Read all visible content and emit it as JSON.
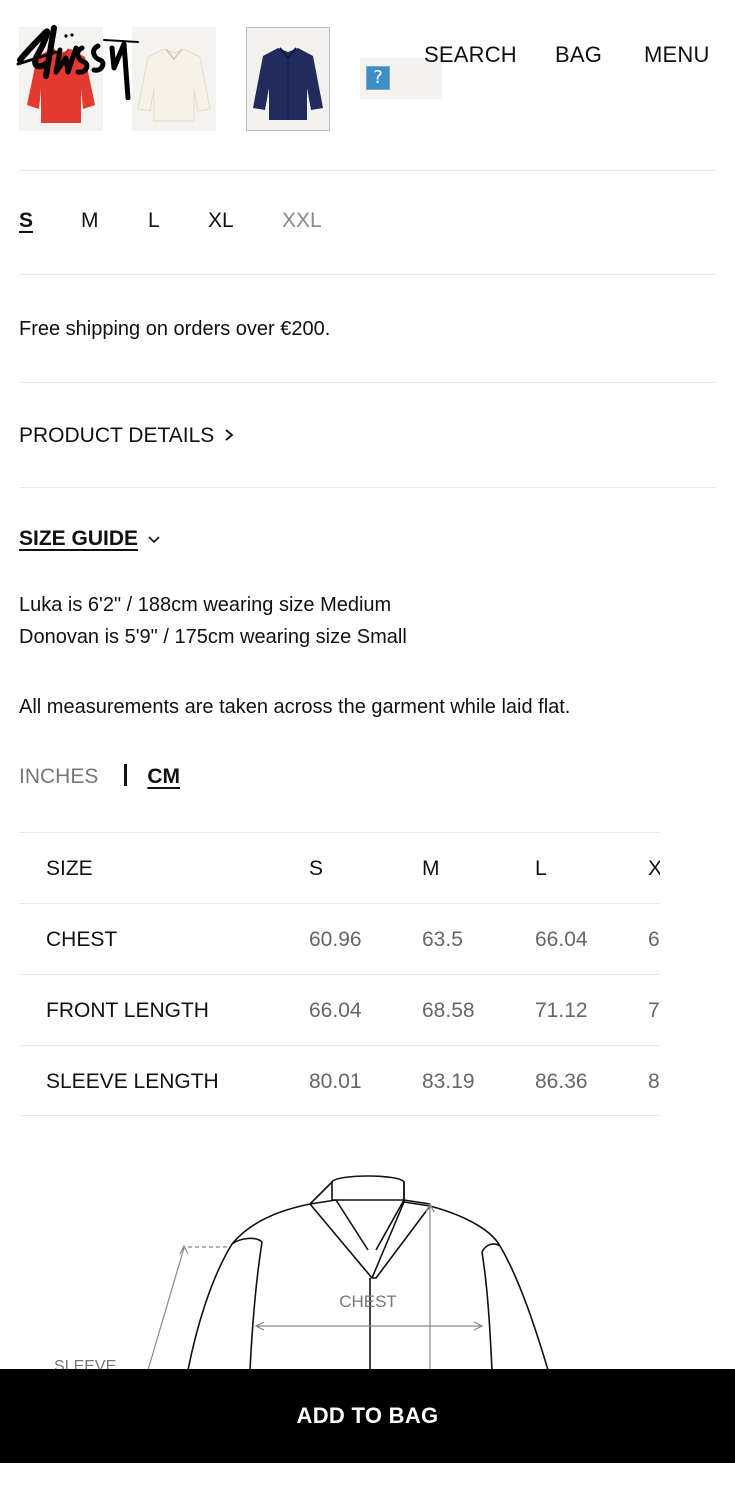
{
  "header": {
    "brand": "Stüssy",
    "nav": {
      "search": "SEARCH",
      "bag": "BAG",
      "menu": "MENU"
    },
    "thumbnails": [
      {
        "name": "red-jacket",
        "color": "#e33c33"
      },
      {
        "name": "cream-jacket",
        "color": "#f3efe6"
      },
      {
        "name": "navy-jacket",
        "color": "#1f2c5c",
        "selected": true
      },
      {
        "name": "missing-image",
        "icon": "question-mark-icon",
        "glyph": "?"
      }
    ]
  },
  "sizes": {
    "options": [
      {
        "label": "S",
        "state": "selected"
      },
      {
        "label": "M",
        "state": "available"
      },
      {
        "label": "L",
        "state": "available"
      },
      {
        "label": "XL",
        "state": "available"
      },
      {
        "label": "XXL",
        "state": "unavailable"
      }
    ]
  },
  "shipping": {
    "text": "Free shipping on orders over €200."
  },
  "product_details": {
    "label": "PRODUCT DETAILS",
    "icon": "chevron-right-icon"
  },
  "size_guide": {
    "label": "SIZE GUIDE",
    "icon": "chevron-down-icon",
    "model_lines": [
      "Luka is 6'2\" / 188cm wearing size Medium",
      "Donovan is 5'9\" / 175cm wearing size Small"
    ],
    "note": "All measurements are taken across the garment while laid flat.",
    "units": {
      "inches": "INCHES",
      "cm": "CM",
      "selected": "CM"
    },
    "table": {
      "headers": [
        "SIZE",
        "S",
        "M",
        "L",
        "X"
      ],
      "rows": [
        {
          "label": "CHEST",
          "values": [
            "60.96",
            "63.5",
            "66.04",
            "6"
          ]
        },
        {
          "label": "FRONT LENGTH",
          "values": [
            "66.04",
            "68.58",
            "71.12",
            "7"
          ]
        },
        {
          "label": "SLEEVE LENGTH",
          "values": [
            "80.01",
            "83.19",
            "86.36",
            "8"
          ]
        }
      ]
    },
    "diagram": {
      "chest_label": "CHEST",
      "sleeve_label": "SLEEVE"
    }
  },
  "add_to_bag": {
    "label": "ADD TO BAG"
  },
  "colors": {
    "accent": "#000000",
    "muted": "#777777",
    "rule": "#e8e8e8"
  }
}
